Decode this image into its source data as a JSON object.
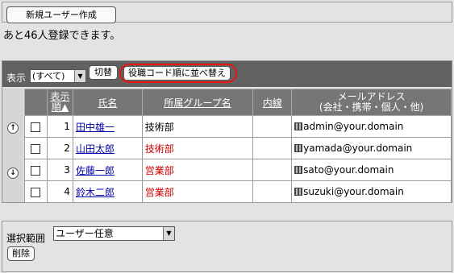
{
  "top": {
    "new_user_label": "新規ユーザー作成",
    "remaining_text": "あと46人登録できます。"
  },
  "toolbar": {
    "show_label": "表示",
    "show_value": "(すべて)",
    "switch_label": "切替",
    "sort_label": "役職コード順に並べ替え"
  },
  "table": {
    "headers": {
      "order": "表示順▲",
      "name": "氏名",
      "group": "所属グループ名",
      "extension": "内線",
      "email_line1": "メールアドレス",
      "email_line2": "(会社・携帯・個人・他)"
    },
    "rows": [
      {
        "order": "1",
        "name": "田中雄一",
        "group": "技術部",
        "group_color": "#000000",
        "email": "admin@your.domain"
      },
      {
        "order": "2",
        "name": "山田太郎",
        "group": "技術部",
        "group_color": "#cc0000",
        "email": "yamada@your.domain"
      },
      {
        "order": "3",
        "name": "佐藤一郎",
        "group": "営業部",
        "group_color": "#cc0000",
        "email": "sato@your.domain"
      },
      {
        "order": "4",
        "name": "鈴木二郎",
        "group": "営業部",
        "group_color": "#cc0000",
        "email": "suzuki@your.domain"
      }
    ]
  },
  "bottom": {
    "range_label": "選択範囲",
    "range_value": "ユーザー任意",
    "delete_label": "削除"
  },
  "colors": {
    "toolbar_bg": "#616161",
    "header_bg": "#767676",
    "highlight_ring": "#e11111",
    "link": "#0000aa"
  }
}
